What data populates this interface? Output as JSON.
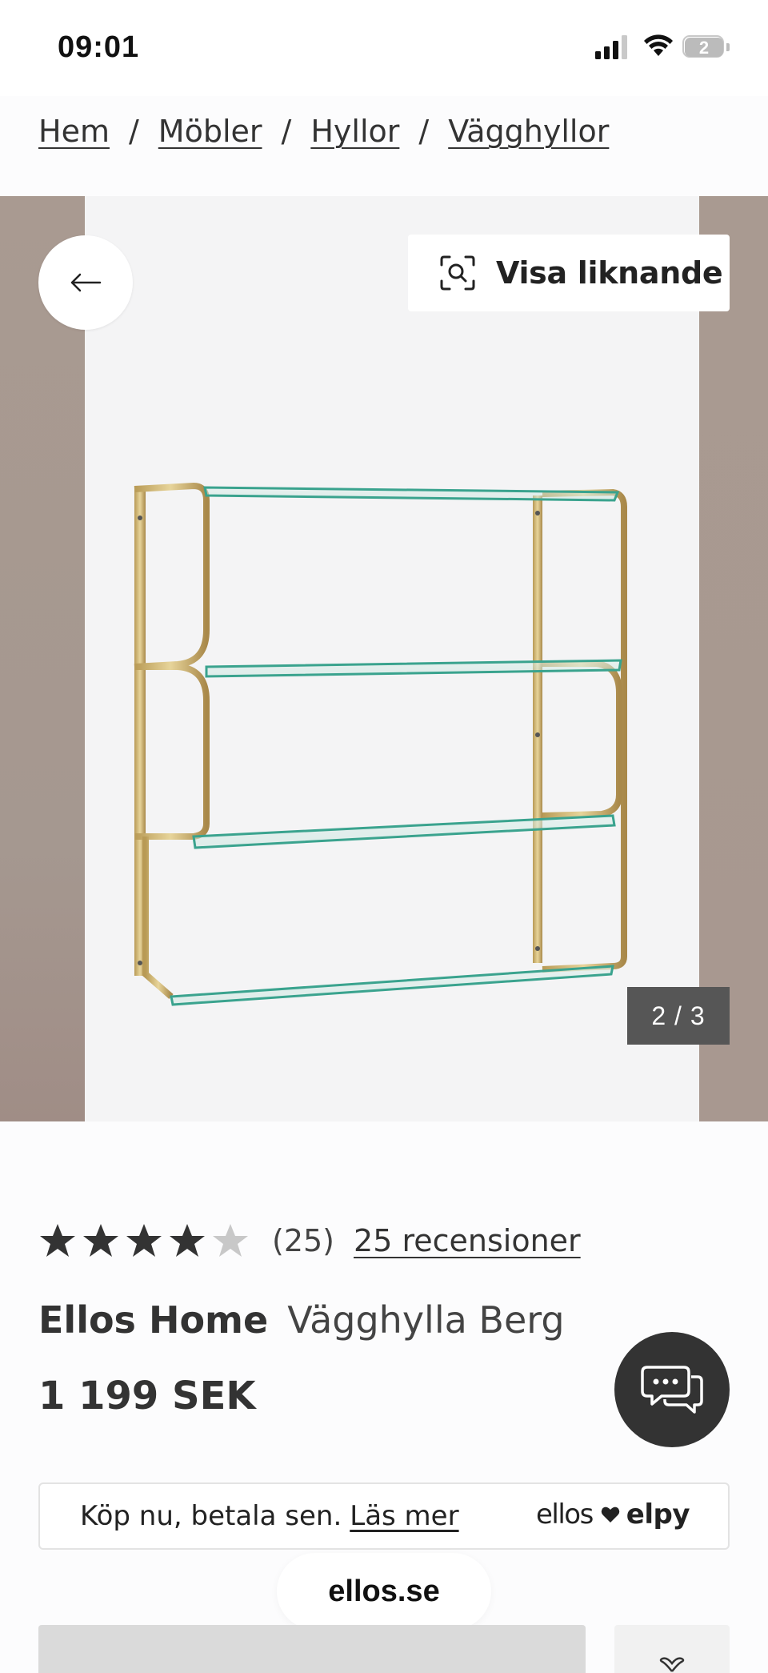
{
  "status_bar": {
    "time": "09:01",
    "battery_level": "2"
  },
  "breadcrumb": {
    "items": [
      "Hem",
      "Möbler",
      "Hyllor",
      "Vägghyllor"
    ],
    "separator": "/"
  },
  "gallery": {
    "back_icon": "arrow-left-icon",
    "similar_button_label": "Visa liknande",
    "similar_icon": "visual-search-icon",
    "counter": "2 / 3",
    "current_image": 2,
    "total_images": 3
  },
  "product": {
    "rating": 4,
    "rating_max": 5,
    "rating_count": "(25)",
    "reviews_link": "25 recensioner",
    "brand": "Ellos Home",
    "name": "Vägghylla Berg",
    "price": "1 199 SEK"
  },
  "chat": {
    "icon": "chat-bubbles-icon"
  },
  "payment_banner": {
    "text": "Köp nu, betala sen.",
    "link": "Läs mer",
    "brand_left": "ellos",
    "brand_right": "elpy"
  },
  "browser": {
    "url": "ellos.se"
  },
  "colors": {
    "background": "#fcfcfd",
    "star_filled": "#333333",
    "star_empty": "#c8c8c8",
    "chat_button": "#333333",
    "counter_bg": "#565656",
    "wall": "#a8998f"
  }
}
